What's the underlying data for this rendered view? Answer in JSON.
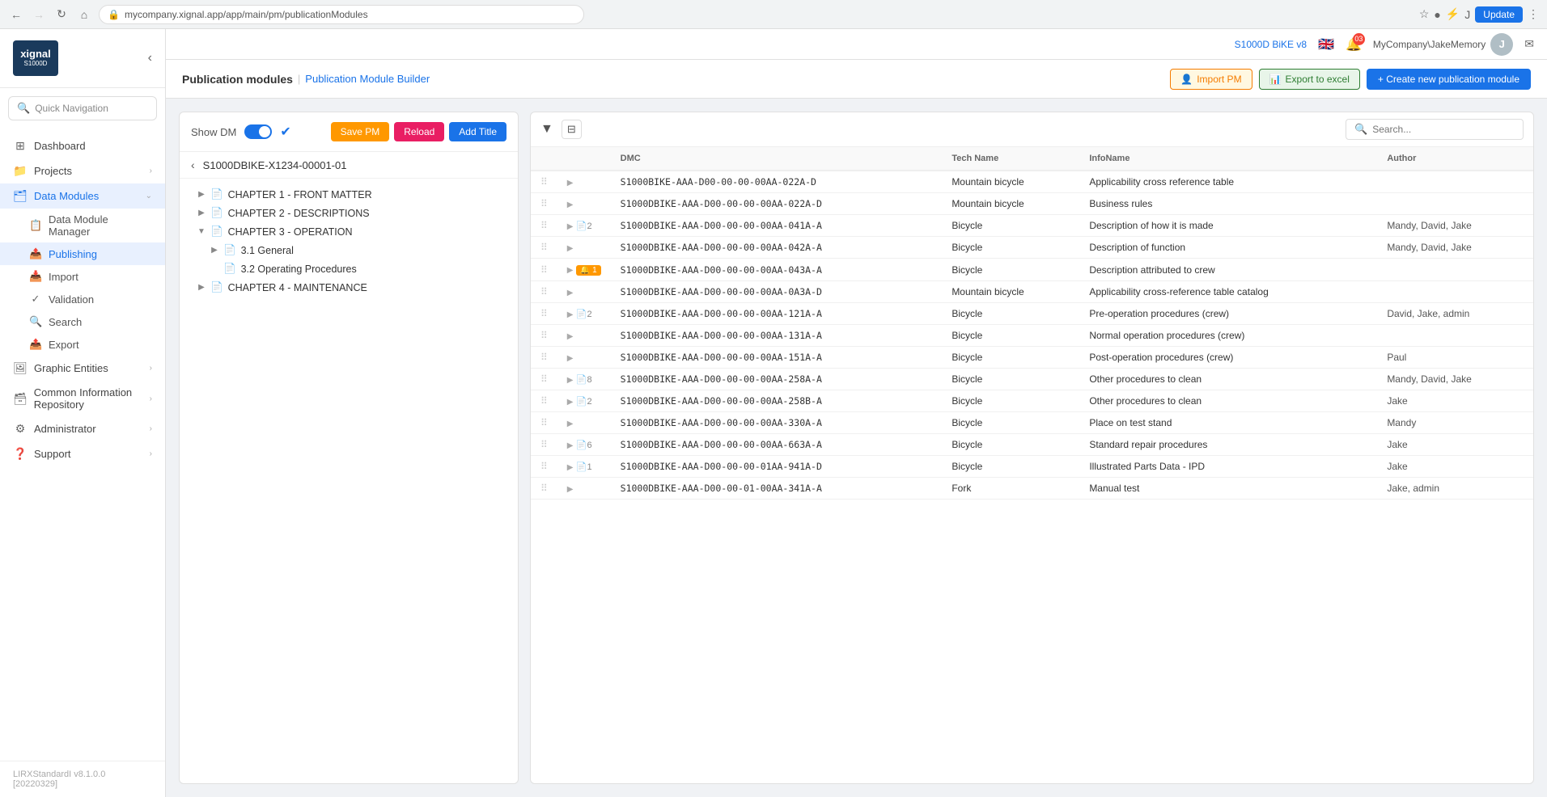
{
  "browser": {
    "url": "mycompany.xignal.app/app/main/pm/publicationModules",
    "update_label": "Update"
  },
  "topbar": {
    "s1000d_label": "S1000D BiKE v8",
    "notification_count": "03",
    "user": "MyCompany\\JakeMemory",
    "avatar_letter": "J"
  },
  "header": {
    "title": "Publication modules",
    "subtitle": "Publication Module Builder",
    "import_pm": "Import PM",
    "export_excel": "Export to excel",
    "create_pm": "+ Create new publication module"
  },
  "sidebar": {
    "quick_nav_placeholder": "Quick Navigation",
    "nav_items": [
      {
        "id": "dashboard",
        "label": "Dashboard",
        "icon": "⊞"
      },
      {
        "id": "projects",
        "label": "Projects",
        "icon": "📁",
        "has_children": true
      },
      {
        "id": "data-modules",
        "label": "Data Modules",
        "icon": "🗂",
        "has_children": true,
        "active": true
      },
      {
        "id": "dm-manager",
        "label": "Data Module Manager",
        "icon": "📋",
        "sub": true
      },
      {
        "id": "publishing",
        "label": "Publishing",
        "icon": "📤",
        "sub": true,
        "active": true
      },
      {
        "id": "import",
        "label": "Import",
        "icon": "📥",
        "sub": true
      },
      {
        "id": "validation",
        "label": "Validation",
        "icon": "✓",
        "sub": true
      },
      {
        "id": "search",
        "label": "Search",
        "icon": "🔍",
        "sub": true
      },
      {
        "id": "export",
        "label": "Export",
        "icon": "📤",
        "sub": true
      },
      {
        "id": "graphic-entities",
        "label": "Graphic Entities",
        "icon": "🖼",
        "has_children": true
      },
      {
        "id": "common-info",
        "label": "Common Information Repository",
        "icon": "🗃",
        "has_children": true
      },
      {
        "id": "administrator",
        "label": "Administrator",
        "icon": "⚙",
        "has_children": true
      },
      {
        "id": "support",
        "label": "Support",
        "icon": "❓",
        "has_children": true
      }
    ],
    "footer": "LIRXStandardI v8.1.0.0 [20220329]"
  },
  "pm_panel": {
    "show_dm_label": "Show DM",
    "pm_id": "S1000DBIKE-X1234-00001-01",
    "save_label": "Save PM",
    "reload_label": "Reload",
    "add_title_label": "Add Title",
    "tree": [
      {
        "level": 1,
        "label": "CHAPTER 1 - FRONT MATTER",
        "expanded": false
      },
      {
        "level": 1,
        "label": "CHAPTER 2 - DESCRIPTIONS",
        "expanded": false
      },
      {
        "level": 1,
        "label": "CHAPTER 3 - OPERATION",
        "expanded": true
      },
      {
        "level": 2,
        "label": "3.1 General",
        "expanded": false
      },
      {
        "level": 2,
        "label": "3.2 Operating Procedures",
        "expanded": false
      },
      {
        "level": 1,
        "label": "CHAPTER 4 - MAINTENANCE",
        "expanded": false
      }
    ]
  },
  "dm_table": {
    "search_placeholder": "Search...",
    "columns": [
      "",
      "",
      "DMC",
      "Tech Name",
      "InfoName",
      "Author"
    ],
    "rows": [
      {
        "dmc": "S1000BIKE-AAA-D00-00-00-00AA-022A-D",
        "tech_name": "Mountain bicycle",
        "info_name": "Applicability cross reference table",
        "author": "",
        "badge": null,
        "icons": ""
      },
      {
        "dmc": "S1000DBIKE-AAA-D00-00-00-00AA-022A-D",
        "tech_name": "Mountain bicycle",
        "info_name": "Business rules",
        "author": "",
        "badge": null,
        "icons": ""
      },
      {
        "dmc": "S1000DBIKE-AAA-D00-00-00-00AA-041A-A",
        "tech_name": "Bicycle",
        "info_name": "Description of how it is made",
        "author": "Mandy, David, Jake",
        "badge": null,
        "icons": "doc2"
      },
      {
        "dmc": "S1000DBIKE-AAA-D00-00-00-00AA-042A-A",
        "tech_name": "Bicycle",
        "info_name": "Description of function",
        "author": "Mandy, David, Jake",
        "badge": null,
        "icons": ""
      },
      {
        "dmc": "S1000DBIKE-AAA-D00-00-00-00AA-043A-A",
        "tech_name": "Bicycle",
        "info_name": "Description attributed to crew",
        "author": "",
        "badge": "1",
        "icons": ""
      },
      {
        "dmc": "S1000DBIKE-AAA-D00-00-00-00AA-0A3A-D",
        "tech_name": "Mountain bicycle",
        "info_name": "Applicability cross-reference table catalog",
        "author": "",
        "badge": null,
        "icons": ""
      },
      {
        "dmc": "S1000DBIKE-AAA-D00-00-00-00AA-121A-A",
        "tech_name": "Bicycle",
        "info_name": "Pre-operation procedures (crew)",
        "author": "David, Jake, admin",
        "badge": null,
        "icons": "doc2"
      },
      {
        "dmc": "S1000DBIKE-AAA-D00-00-00-00AA-131A-A",
        "tech_name": "Bicycle",
        "info_name": "Normal operation procedures (crew)",
        "author": "",
        "badge": null,
        "icons": ""
      },
      {
        "dmc": "S1000DBIKE-AAA-D00-00-00-00AA-151A-A",
        "tech_name": "Bicycle",
        "info_name": "Post-operation procedures (crew)",
        "author": "Paul",
        "badge": null,
        "icons": ""
      },
      {
        "dmc": "S1000DBIKE-AAA-D00-00-00-00AA-258A-A",
        "tech_name": "Bicycle",
        "info_name": "Other procedures to clean",
        "author": "Mandy, David, Jake",
        "badge": null,
        "icons": "doc8"
      },
      {
        "dmc": "S1000DBIKE-AAA-D00-00-00-00AA-258B-A",
        "tech_name": "Bicycle",
        "info_name": "Other procedures to clean",
        "author": "Jake",
        "badge": null,
        "icons": "doc2"
      },
      {
        "dmc": "S1000DBIKE-AAA-D00-00-00-00AA-330A-A",
        "tech_name": "Bicycle",
        "info_name": "Place on test stand",
        "author": "Mandy",
        "badge": null,
        "icons": ""
      },
      {
        "dmc": "S1000DBIKE-AAA-D00-00-00-00AA-663A-A",
        "tech_name": "Bicycle",
        "info_name": "Standard repair procedures",
        "author": "Jake",
        "badge": null,
        "icons": "doc6"
      },
      {
        "dmc": "S1000DBIKE-AAA-D00-00-00-01AA-941A-D",
        "tech_name": "Bicycle",
        "info_name": "Illustrated Parts Data - IPD",
        "author": "Jake",
        "badge": null,
        "icons": "doc1"
      },
      {
        "dmc": "S1000DBIKE-AAA-D00-00-01-00AA-341A-A",
        "tech_name": "Fork",
        "info_name": "Manual test",
        "author": "Jake, admin",
        "badge": null,
        "icons": ""
      }
    ]
  }
}
